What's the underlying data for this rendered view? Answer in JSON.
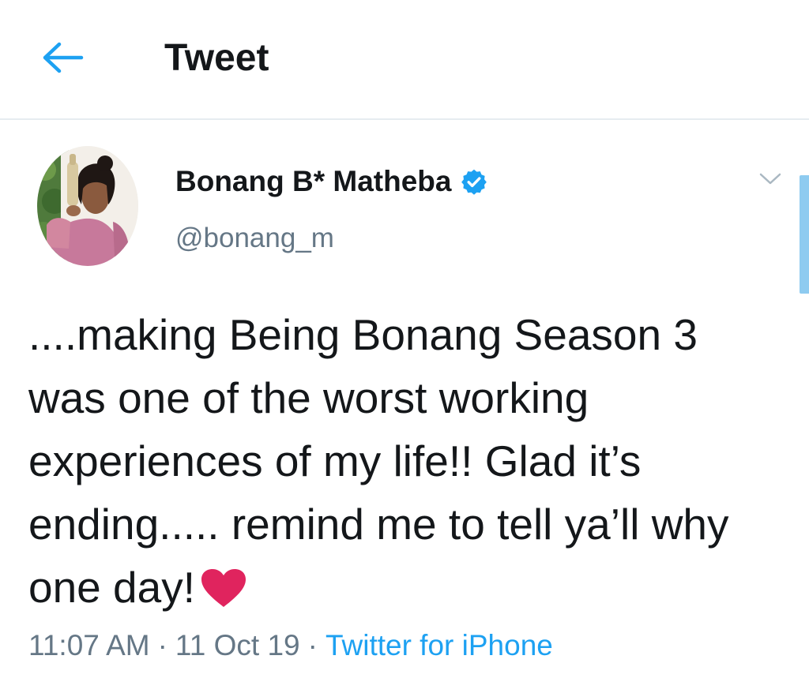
{
  "header": {
    "back_icon": "arrow-left-icon",
    "title": "Tweet"
  },
  "tweet": {
    "author": {
      "display_name": "Bonang B* Matheba",
      "handle": "@bonang_m",
      "verified": true,
      "verified_icon": "verified-badge-icon"
    },
    "menu_icon": "chevron-down-icon",
    "text": "....making Being Bonang Season 3 was one of the worst working experiences of my life!! Glad it’s ending..... remind me to tell ya’ll why one day!",
    "emoji": "heart-icon",
    "meta": {
      "time": "11:07 AM",
      "separator": "·",
      "date": "11 Oct 19",
      "source": "Twitter for iPhone"
    }
  },
  "colors": {
    "accent": "#1da1f2",
    "text_primary": "#14171a",
    "text_secondary": "#657786",
    "heart": "#e0245e",
    "divider": "#e6ecf0"
  }
}
